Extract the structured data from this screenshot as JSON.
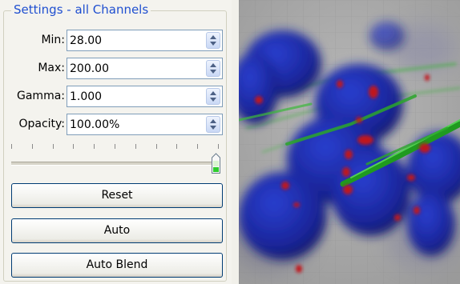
{
  "settings": {
    "group_title": "Settings - all Channels",
    "fields": [
      {
        "label": "Min:",
        "value": "28.00"
      },
      {
        "label": "Max:",
        "value": "200.00"
      },
      {
        "label": "Gamma:",
        "value": "1.000"
      },
      {
        "label": "Opacity:",
        "value": "100.00%"
      }
    ],
    "opacity_slider_fraction": 1.0,
    "buttons": {
      "reset": "Reset",
      "auto": "Auto",
      "auto_blend": "Auto Blend"
    }
  },
  "colors": {
    "group_title": "#1f4fd0",
    "button_border": "#003c74",
    "channel_blue": "#1f2fa8",
    "channel_green": "#2a9a2a",
    "channel_red": "#c0141c"
  },
  "icons": {
    "spin_up": "triangle-up-icon",
    "spin_down": "triangle-down-icon",
    "slider_thumb": "slider-thumb-icon"
  }
}
